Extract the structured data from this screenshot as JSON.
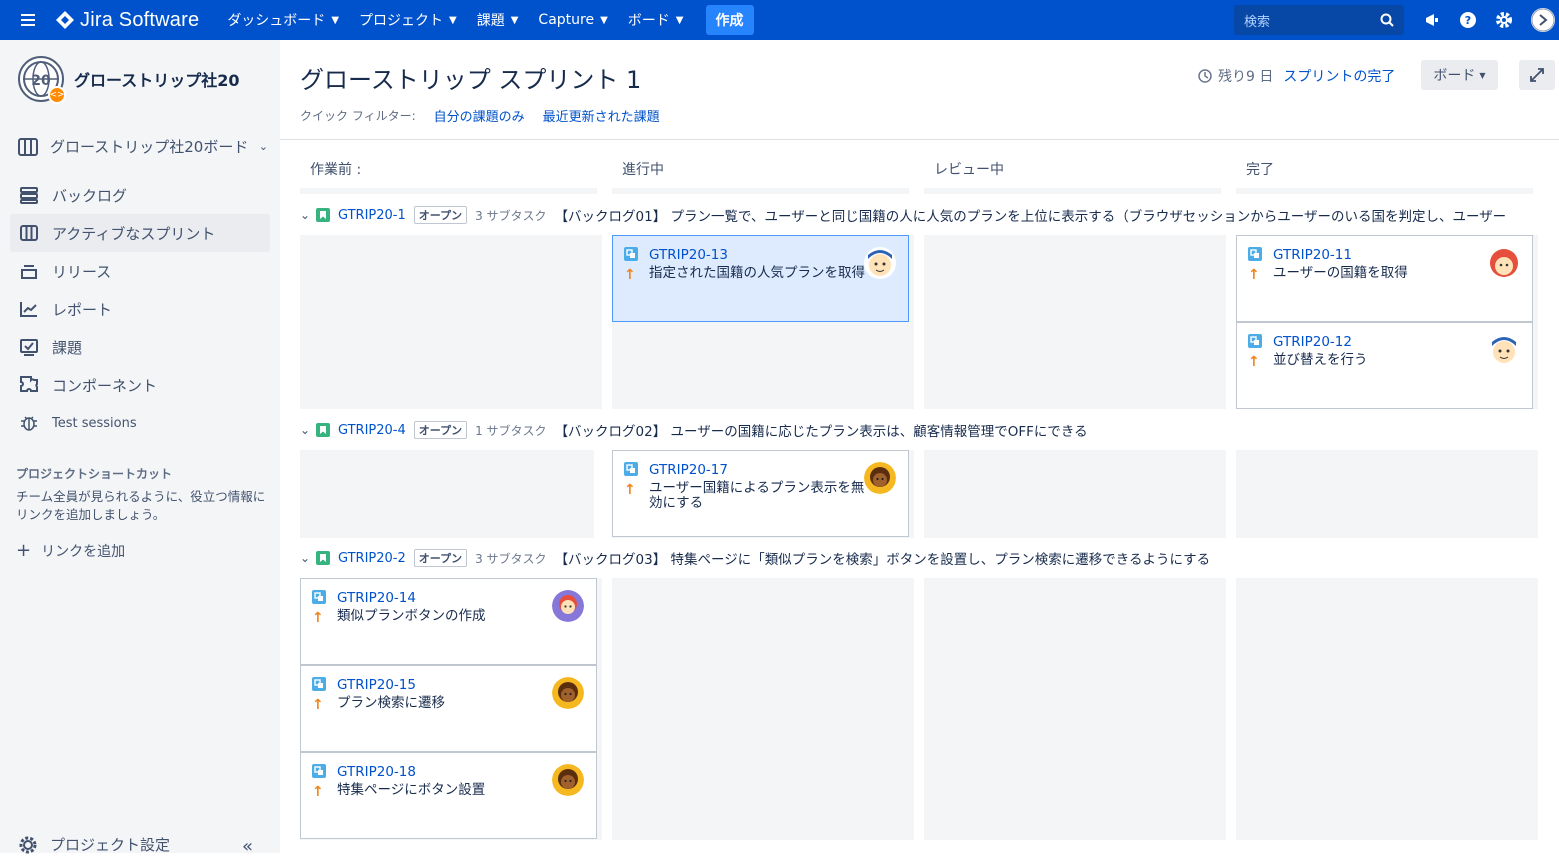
{
  "topbar": {
    "logo": "Jira Software",
    "menus": [
      "ダッシュボード",
      "プロジェクト",
      "課題",
      "Capture",
      "ボード"
    ],
    "create": "作成",
    "search_placeholder": "検索"
  },
  "sidebar": {
    "project_name": "グローストリップ社20",
    "board_selector": "グローストリップ社20ボード",
    "items": [
      {
        "label": "バックログ",
        "icon": "backlog-icon"
      },
      {
        "label": "アクティブなスプリント",
        "icon": "board-icon",
        "active": true
      },
      {
        "label": "リリース",
        "icon": "release-icon"
      },
      {
        "label": "レポート",
        "icon": "report-icon"
      },
      {
        "label": "課題",
        "icon": "issues-icon"
      },
      {
        "label": "コンポーネント",
        "icon": "component-icon"
      },
      {
        "label": "Test sessions",
        "icon": "bug-icon"
      }
    ],
    "shortcuts_heading": "プロジェクトショートカット",
    "shortcuts_text": "チーム全員が見られるように、役立つ情報にリンクを追加しましょう。",
    "add_link": "リンクを追加",
    "project_settings": "プロジェクト設定"
  },
  "main": {
    "title": "グローストリップ スプリント 1",
    "quick_filter_label": "クイック フィルター:",
    "filters": [
      "自分の課題のみ",
      "最近更新された課題"
    ],
    "remaining": "残り9 日",
    "complete_sprint": "スプリントの完了",
    "board_button": "ボード"
  },
  "columns": [
    "作業前 :",
    "進行中",
    "レビュー中",
    "完了"
  ],
  "swimlanes": [
    {
      "key": "GTRIP20-1",
      "status": "オープン",
      "subtasks": "3 サブタスク",
      "summary": "【バックログ01】 プラン一覧で、ユーザーと同じ国籍の人に人気のプランを上位に表示する（ブラウザセッションからユーザーのいる国を判定し、ユーザー"
    },
    {
      "key": "GTRIP20-4",
      "status": "オープン",
      "subtasks": "1 サブタスク",
      "summary": "【バックログ02】 ユーザーの国籍に応じたプラン表示は、顧客情報管理でOFFにできる"
    },
    {
      "key": "GTRIP20-2",
      "status": "オープン",
      "subtasks": "3 サブタスク",
      "summary": "【バックログ03】 特集ページに「類似プランを検索」ボタンを設置し、プラン検索に遷移できるようにする"
    }
  ],
  "cards": [
    {
      "key": "GTRIP20-13",
      "summary": "指定された国籍の人気プランを取得",
      "avatar": "blue-hair-man"
    },
    {
      "key": "GTRIP20-11",
      "summary": "ユーザーの国籍を取得",
      "avatar": "red-hair-woman"
    },
    {
      "key": "GTRIP20-12",
      "summary": "並び替えを行う",
      "avatar": "blue-hair-man"
    },
    {
      "key": "GTRIP20-17",
      "summary": "ユーザー国籍によるプラン表示を無効にする",
      "avatar": "dark-woman"
    },
    {
      "key": "GTRIP20-14",
      "summary": "類似プランボタンの作成",
      "avatar": "purple-woman"
    },
    {
      "key": "GTRIP20-15",
      "summary": "プラン検索に遷移",
      "avatar": "dark-woman"
    },
    {
      "key": "GTRIP20-18",
      "summary": "特集ページにボタン設置",
      "avatar": "dark-woman"
    }
  ]
}
